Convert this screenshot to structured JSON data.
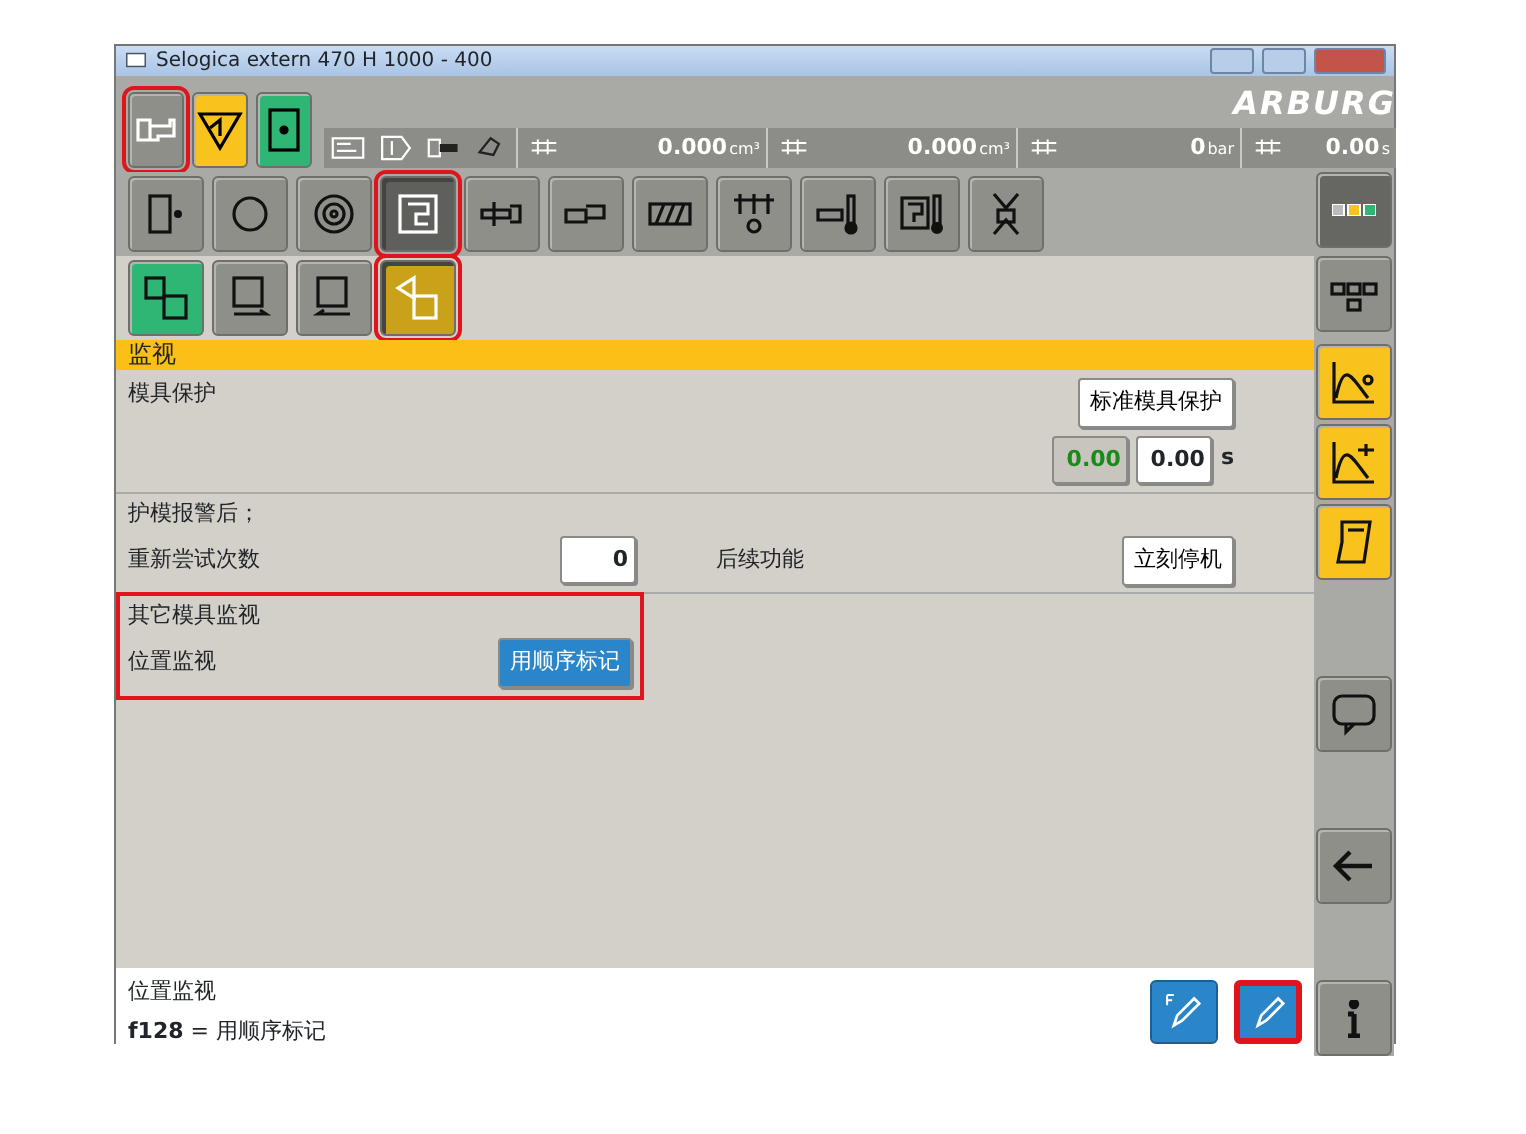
{
  "window": {
    "title": "Selogica extern  470 H  1000 -  400"
  },
  "mode_buttons": [
    {
      "color": "#8f8f8a",
      "highlighted": true
    },
    {
      "color": "#f7c31c",
      "highlighted": false
    },
    {
      "color": "#2fb574",
      "highlighted": false
    }
  ],
  "logo": "ARBURG",
  "status_bar": {
    "readings": [
      {
        "value": "0.000",
        "unit": "cm³"
      },
      {
        "value": "0.000",
        "unit": "cm³"
      },
      {
        "value": "0",
        "unit": "bar"
      },
      {
        "value": "0.00",
        "unit": "s"
      }
    ]
  },
  "function_tabs": [
    {
      "selected": false,
      "highlighted": false
    },
    {
      "selected": false,
      "highlighted": false
    },
    {
      "selected": false,
      "highlighted": false
    },
    {
      "selected": true,
      "highlighted": true
    },
    {
      "selected": false,
      "highlighted": false
    },
    {
      "selected": false,
      "highlighted": false
    },
    {
      "selected": false,
      "highlighted": false
    },
    {
      "selected": false,
      "highlighted": false
    },
    {
      "selected": false,
      "highlighted": false
    },
    {
      "selected": false,
      "highlighted": false
    },
    {
      "selected": false,
      "highlighted": false
    }
  ],
  "sub_tabs": [
    {
      "color": "#2fb574",
      "selected": false,
      "highlighted": false
    },
    {
      "color": "#8f8f8a",
      "selected": false,
      "highlighted": false
    },
    {
      "color": "#8f8f8a",
      "selected": false,
      "highlighted": false
    },
    {
      "color": "#c9a21a",
      "selected": true,
      "highlighted": true
    }
  ],
  "section_title": "监视",
  "mold_protection": {
    "label": "模具保护",
    "mode_button": "标准模具保护",
    "actual_value": "0.00",
    "set_value": "0.00",
    "unit": "s"
  },
  "after_alarm": {
    "heading": "护模报警后；",
    "retry_label": "重新尝试次数",
    "retry_value": "0",
    "follow_label": "后续功能",
    "follow_button": "立刻停机"
  },
  "other_monitoring": {
    "heading": "其它模具监视",
    "position_label": "位置监视",
    "position_button": "用顺序标记",
    "highlighted": true
  },
  "info_bar": {
    "title": "位置监视",
    "detail": "**f128** = 用顺序标记",
    "buttons": [
      {
        "kind": "f-edit",
        "highlighted": false
      },
      {
        "kind": "edit",
        "highlighted": true
      }
    ]
  },
  "sidebar": [
    {
      "color": "#666663"
    },
    {
      "color": "#8f8f8a"
    },
    {
      "color": "#f7c31c"
    },
    {
      "color": "#f7c31c"
    },
    {
      "color": "#f7c31c"
    },
    {
      "color": "#8f8f8a"
    },
    {
      "color": "#8f8f8a"
    },
    {
      "color": "#8f8f8a"
    }
  ]
}
